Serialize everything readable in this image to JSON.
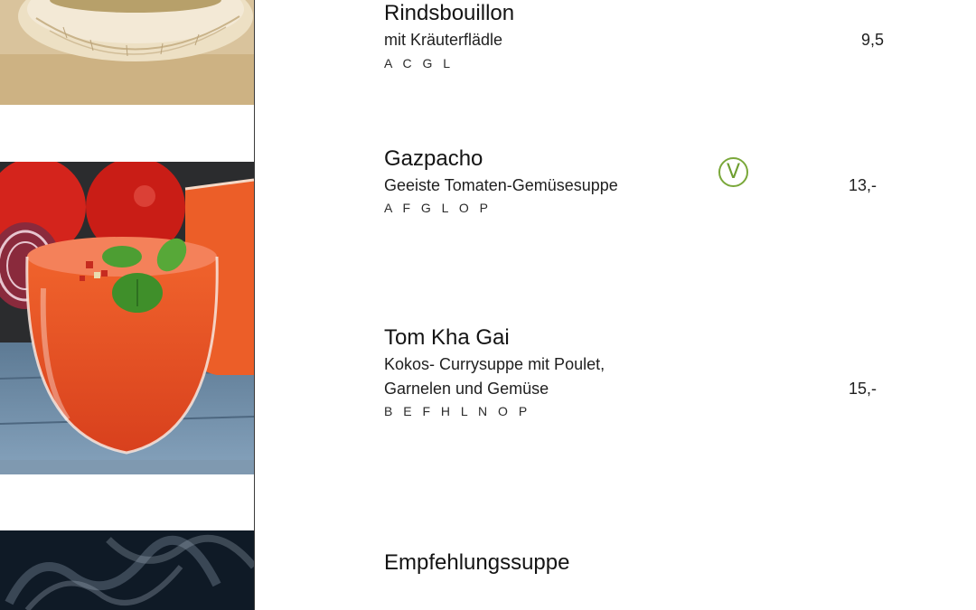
{
  "menu": {
    "items": [
      {
        "name": "Rindsbouillon",
        "description": [
          "mit Kräuterflädle"
        ],
        "allergens": "A C G L",
        "price": "9,5"
      },
      {
        "name": "Gazpacho",
        "description": [
          "Geeiste Tomaten-Gemüsesuppe"
        ],
        "allergens": "A F G L O P",
        "price": "13,-",
        "badge": "V"
      },
      {
        "name": "Tom Kha Gai",
        "description": [
          "Kokos- Currysuppe mit Poulet,",
          "Garnelen und Gemüse"
        ],
        "allergens": "B E F H L N O P",
        "price": "15,-"
      },
      {
        "name": "Empfehlungssuppe"
      }
    ]
  },
  "colors": {
    "vegetarian_badge": "#7aa83a",
    "divider": "#3a3a3a"
  },
  "icons": {
    "vegetarian": "vegetarian-badge-icon"
  }
}
